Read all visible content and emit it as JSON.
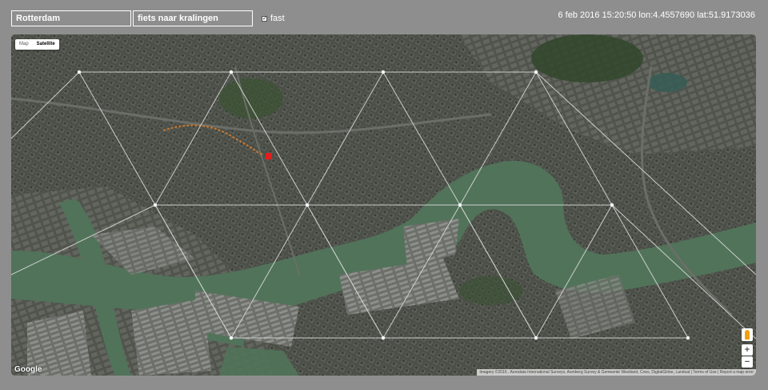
{
  "form": {
    "location_value": "Rotterdam",
    "query_value": "fiets naar kralingen",
    "fast_label": "fast",
    "fast_checked": true
  },
  "status": {
    "text": "6 feb 2016 15:20:50 lon:4.4557690 lat:51.9173036"
  },
  "map": {
    "type_map_label": "Map",
    "type_satellite_label": "Satellite",
    "zoom_in_label": "+",
    "zoom_out_label": "−",
    "logo_text": "Google",
    "attribution": "Imagery ©2016 , Aerodata International Surveys, Asmberg Survey & Gemeente Westland, Cnes, DigitalGlobe, Landsat | Terms of Use | Report a map error",
    "colors": {
      "water": "#51735a",
      "urban": "#4a4f46",
      "greenery": "#3e5434",
      "grid_line": "#d9d9d9",
      "marker": "#e21d1d"
    }
  }
}
